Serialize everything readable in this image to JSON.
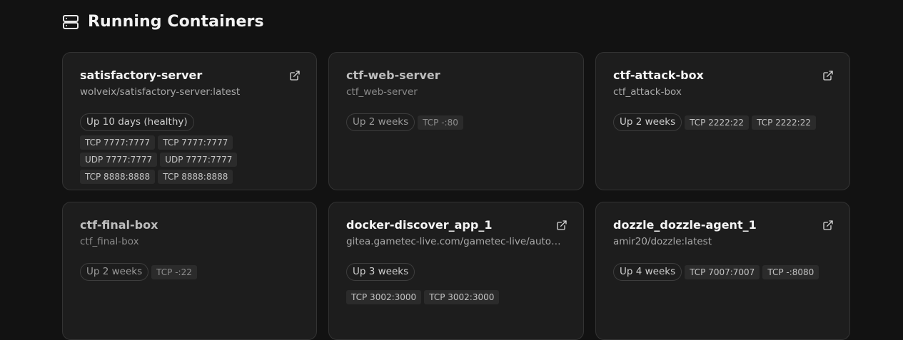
{
  "header": {
    "title": "Running Containers",
    "icon": "server-icon"
  },
  "containers": [
    {
      "name": "satisfactory-server",
      "image": "wolveix/satisfactory-server:latest",
      "status": "Up 10 days (healthy)",
      "has_link": true,
      "ports": [
        "TCP 7777:7777",
        "TCP 7777:7777",
        "UDP 7777:7777",
        "UDP 7777:7777",
        "TCP 8888:8888",
        "TCP 8888:8888"
      ]
    },
    {
      "name": "ctf-web-server",
      "image": "ctf_web-server",
      "status": "Up 2 weeks",
      "has_link": false,
      "ports": [
        "TCP -:80"
      ]
    },
    {
      "name": "ctf-attack-box",
      "image": "ctf_attack-box",
      "status": "Up 2 weeks",
      "has_link": true,
      "ports": [
        "TCP 2222:22",
        "TCP 2222:22"
      ]
    },
    {
      "name": "ctf-final-box",
      "image": "ctf_final-box",
      "status": "Up 2 weeks",
      "has_link": false,
      "ports": [
        "TCP -:22"
      ]
    },
    {
      "name": "docker-discover_app_1",
      "image": "gitea.gametec-live.com/gametec-live/autodis...",
      "status": "Up 3 weeks",
      "has_link": true,
      "ports": [
        "TCP 3002:3000",
        "TCP 3002:3000"
      ]
    },
    {
      "name": "dozzle_dozzle-agent_1",
      "image": "amir20/dozzle:latest",
      "status": "Up 4 weeks",
      "has_link": true,
      "ports": [
        "TCP 7007:7007",
        "TCP -:8080"
      ]
    }
  ],
  "colors": {
    "background": "#121212",
    "card": "#1d1d1d",
    "card_border": "#333333",
    "port_chip": "#2b2b2b"
  }
}
